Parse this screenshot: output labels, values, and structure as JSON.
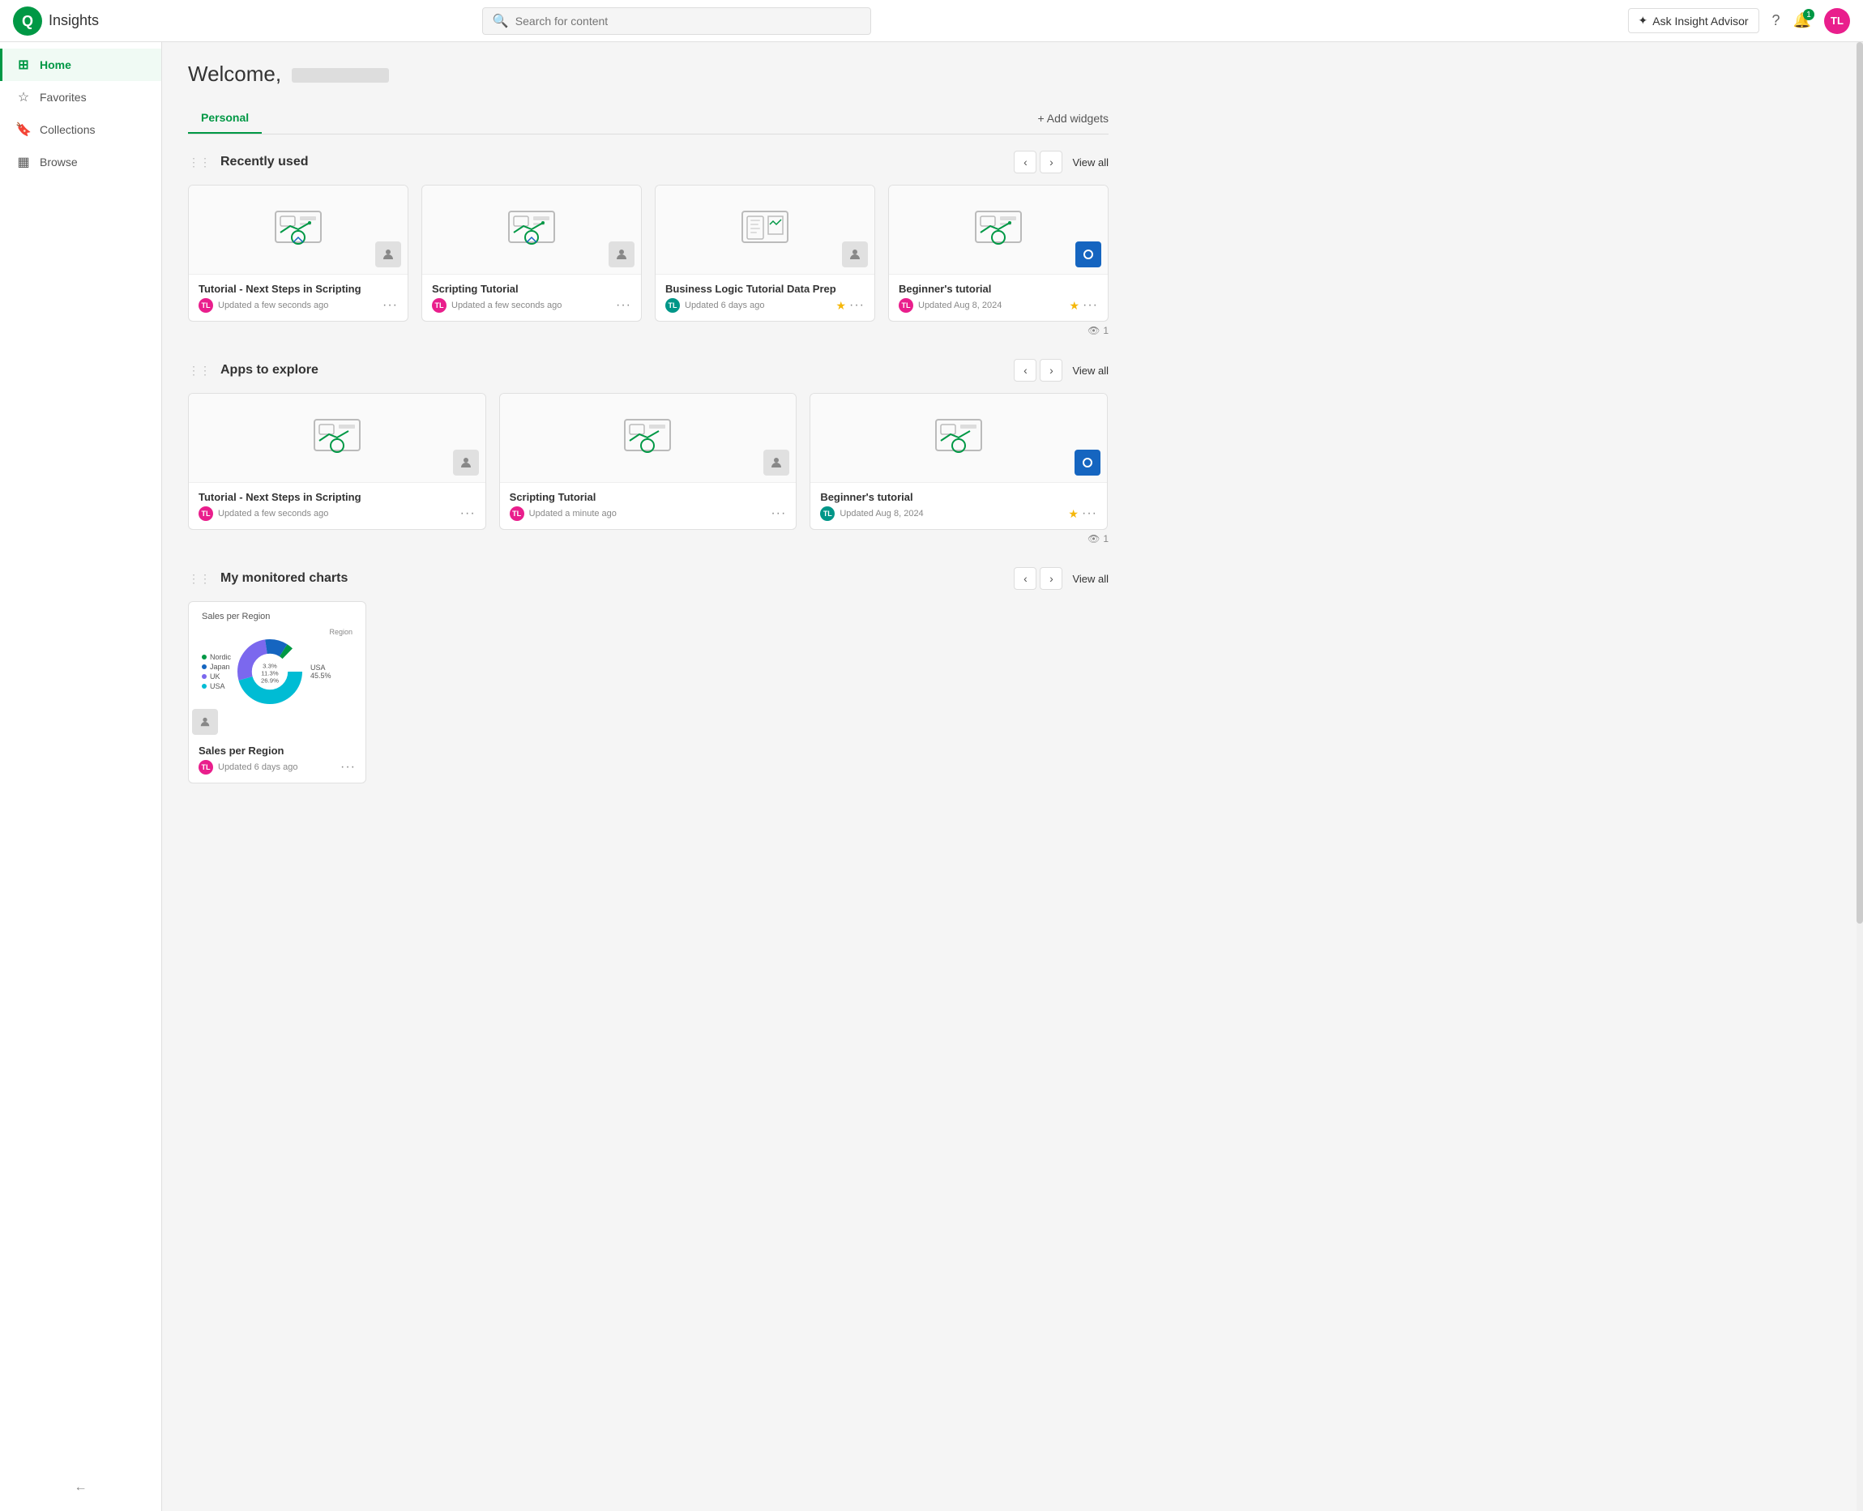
{
  "app": {
    "title": "Insights"
  },
  "topnav": {
    "search_placeholder": "Search for content",
    "insight_advisor_label": "Ask Insight Advisor",
    "notification_count": "1",
    "avatar_initials": "TL"
  },
  "sidebar": {
    "items": [
      {
        "id": "home",
        "label": "Home",
        "icon": "⊞",
        "active": true
      },
      {
        "id": "favorites",
        "label": "Favorites",
        "icon": "☆",
        "active": false
      },
      {
        "id": "collections",
        "label": "Collections",
        "icon": "🔖",
        "active": false
      },
      {
        "id": "browse",
        "label": "Browse",
        "icon": "▦",
        "active": false
      }
    ],
    "collapse_icon": "←"
  },
  "main": {
    "welcome_prefix": "Welcome,",
    "tab_personal": "Personal",
    "add_widgets_label": "+ Add widgets",
    "recently_used": {
      "title": "Recently used",
      "view_all": "View all",
      "view_count": "1",
      "cards": [
        {
          "name": "Tutorial - Next Steps in Scripting",
          "meta": "Updated a few seconds ago",
          "avatar": "TL",
          "avatar_color": "pink",
          "starred": false,
          "app_icon": "person"
        },
        {
          "name": "Scripting Tutorial",
          "meta": "Updated a few seconds ago",
          "avatar": "TL",
          "avatar_color": "pink",
          "starred": false,
          "app_icon": "person"
        },
        {
          "name": "Business Logic Tutorial Data Prep",
          "meta": "Updated 6 days ago",
          "avatar": "TL",
          "avatar_color": "teal",
          "starred": true,
          "app_icon": "person"
        },
        {
          "name": "Beginner's tutorial",
          "meta": "Updated Aug 8, 2024",
          "avatar": "TL",
          "avatar_color": "pink",
          "starred": true,
          "app_icon": "blue-circle"
        }
      ]
    },
    "apps_to_explore": {
      "title": "Apps to explore",
      "view_all": "View all",
      "view_count": "1",
      "cards": [
        {
          "name": "Tutorial - Next Steps in Scripting",
          "meta": "Updated a few seconds ago",
          "avatar": "TL",
          "avatar_color": "pink",
          "starred": false,
          "app_icon": "person"
        },
        {
          "name": "Scripting Tutorial",
          "meta": "Updated a minute ago",
          "avatar": "TL",
          "avatar_color": "pink",
          "starred": false,
          "app_icon": "person"
        },
        {
          "name": "Beginner's tutorial",
          "meta": "Updated Aug 8, 2024",
          "avatar": "TL",
          "avatar_color": "teal",
          "starred": true,
          "app_icon": "blue-circle"
        }
      ]
    },
    "monitored_charts": {
      "title": "My monitored charts",
      "view_all": "View all",
      "cards": [
        {
          "name": "Sales per Region",
          "meta": "Updated 6 days ago",
          "avatar": "TL",
          "avatar_color": "pink",
          "chart_title": "Sales per Region",
          "legend_label": "Region",
          "segments": [
            {
              "label": "Nordic",
              "value": 3.3,
              "color": "#009845"
            },
            {
              "label": "Japan",
              "value": 11.3,
              "color": "#1565c0"
            },
            {
              "label": "UK",
              "value": 26.9,
              "color": "#7b68ee"
            },
            {
              "label": "USA",
              "value": 45.5,
              "color": "#00bcd4"
            }
          ]
        }
      ]
    }
  }
}
